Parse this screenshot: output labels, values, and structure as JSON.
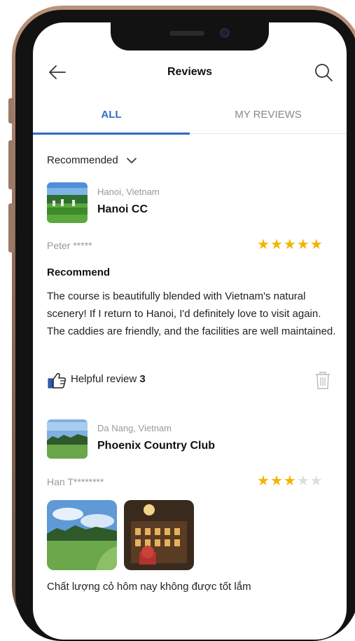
{
  "header": {
    "title": "Reviews",
    "back_icon": "arrow-left-icon",
    "search_icon": "search-icon"
  },
  "tabs": [
    {
      "label": "ALL",
      "active": true
    },
    {
      "label": "MY REVIEWS",
      "active": false
    }
  ],
  "sort": {
    "label": "Recommended"
  },
  "reviews": [
    {
      "location": "Hanoi, Vietnam",
      "club": "Hanoi CC",
      "user": "Peter *****",
      "rating": 5,
      "title": "Recommend",
      "body": "The course is beautifully blended with Vietnam's natural scenery! If I return to Hanoi, I'd definitely love to visit again. The caddies are friendly, and the facilities are well maintained.",
      "helpful_label": "Helpful review",
      "helpful_count": "3"
    },
    {
      "location": "Da Nang, Vietnam",
      "club": "Phoenix Country Club",
      "user": "Han T********",
      "rating": 3,
      "body": "Chất lượng cỏ hôm nay không được tốt lắm"
    }
  ],
  "colors": {
    "accent": "#2e6cc3",
    "star": "#f5b400",
    "star_off": "#dedede"
  }
}
